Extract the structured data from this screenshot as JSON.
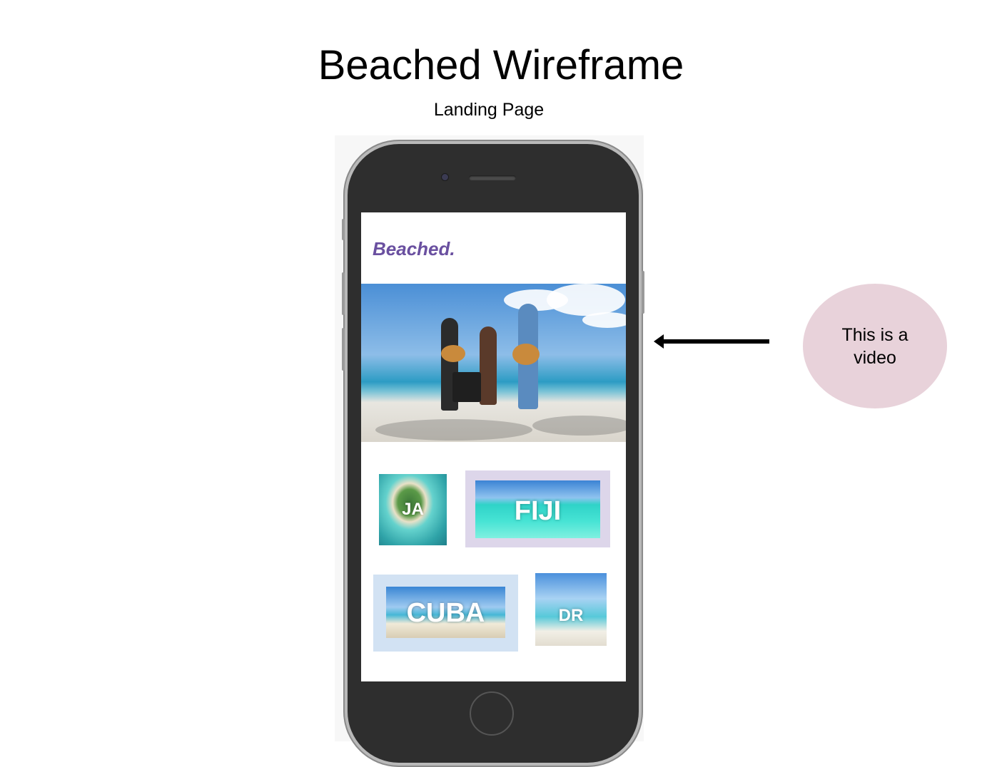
{
  "page": {
    "title": "Beached Wireframe",
    "subtitle": "Landing Page"
  },
  "app": {
    "brand": "Beached.",
    "brand_color": "#6a50a0",
    "hero_media": "video"
  },
  "destinations": [
    {
      "label": "JA"
    },
    {
      "label": "FIJI",
      "card_color": "#ddd6ea"
    },
    {
      "label": "CUBA",
      "card_color": "#d2e2f3"
    },
    {
      "label": "DR"
    }
  ],
  "annotation": {
    "text": "This is a video",
    "bubble_color": "#e8d2da"
  }
}
